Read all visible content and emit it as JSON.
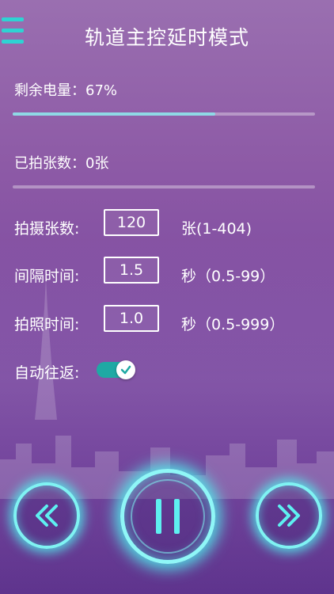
{
  "header": {
    "title": "轨道主控延时模式",
    "menu_icon": "hamburger-menu-icon"
  },
  "status": {
    "battery_label": "剩余电量：67%",
    "battery_percent": 67,
    "photos_taken_label": "已拍张数：0张",
    "photos_taken_percent": 0
  },
  "params": {
    "shot_count": {
      "label": "拍摄张数:",
      "value": "120",
      "unit": "张(1-404)"
    },
    "interval": {
      "label": "间隔时间:",
      "value": "1.5",
      "unit": "秒（0.5-99）"
    },
    "exposure": {
      "label": "拍照时间:",
      "value": "1.0",
      "unit": "秒（0.5-999）"
    },
    "auto_return": {
      "label": "自动往返:",
      "enabled": true
    }
  },
  "controls": {
    "rewind_icon": "rewind-icon",
    "pause_icon": "pause-icon",
    "fast_forward_icon": "fast-forward-icon"
  },
  "colors": {
    "accent": "#2ed3d3",
    "glow": "#7ff3f3",
    "toggle_on": "#1fa9a4",
    "progress": "#8fd9e6"
  }
}
